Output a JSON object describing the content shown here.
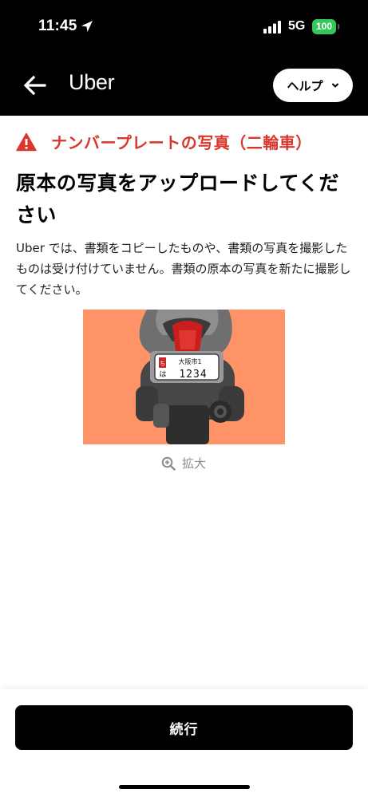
{
  "status_bar": {
    "time": "11:45",
    "network": "5G",
    "battery": "100"
  },
  "nav": {
    "brand": "Uber",
    "help_label": "ヘルプ"
  },
  "alert": {
    "text": "ナンバープレートの写真（二輪車）",
    "color": "#d9362d"
  },
  "headline": "原本の写真をアップロードしてください",
  "description": "Uber では、書類をコピーしたものや、書類の写真を撮影したものは受け付けていません。書類の原本の写真を新たに撮影してください。",
  "illustration": {
    "plate_region": "大阪市1",
    "plate_kana": "は",
    "plate_number": "1234",
    "background_color": "#fd9366"
  },
  "zoom_label": "拡大",
  "continue_label": "続行",
  "icons": {
    "back": "arrow-left-icon",
    "help_chevron": "chevron-down-icon",
    "warning": "warning-triangle-icon",
    "zoom": "zoom-in-icon",
    "location": "location-arrow-icon"
  }
}
